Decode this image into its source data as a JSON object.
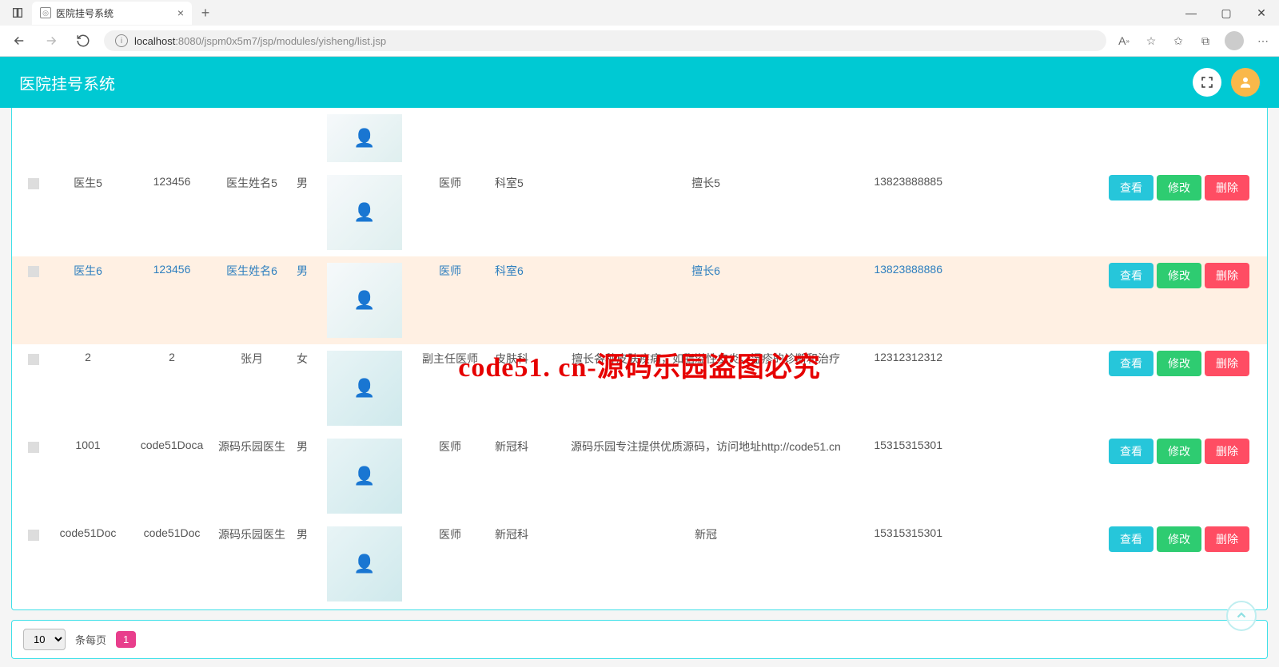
{
  "browser": {
    "tab_title": "医院挂号系统",
    "url_host": "localhost",
    "url_port_path": ":8080/jspm0x5m7/jsp/modules/yisheng/list.jsp"
  },
  "header": {
    "title": "医院挂号系统"
  },
  "buttons": {
    "view": "查看",
    "edit": "修改",
    "delete": "删除"
  },
  "rows": [
    {
      "account": "",
      "password": "",
      "name": "",
      "gender": "",
      "title": "",
      "dept": "",
      "specialty": "",
      "phone": ""
    },
    {
      "account": "医生5",
      "password": "123456",
      "name": "医生姓名5",
      "gender": "男",
      "title": "医师",
      "dept": "科室5",
      "specialty": "擅长5",
      "phone": "13823888885"
    },
    {
      "account": "医生6",
      "password": "123456",
      "name": "医生姓名6",
      "gender": "男",
      "title": "医师",
      "dept": "科室6",
      "specialty": "擅长6",
      "phone": "13823888886"
    },
    {
      "account": "2",
      "password": "2",
      "name": "张月",
      "gender": "女",
      "title": "副主任医师",
      "dept": "皮肤科",
      "specialty": "擅长各种皮肤疾病，如脂溢性皮炎，湿疹的诊断和治疗",
      "phone": "12312312312"
    },
    {
      "account": "1001",
      "password": "code51Doca",
      "name": "源码乐园医生",
      "gender": "男",
      "title": "医师",
      "dept": "新冠科",
      "specialty": "源码乐园专注提供优质源码，访问地址http://code51.cn",
      "phone": "15315315301"
    },
    {
      "account": "code51Doc",
      "password": "code51Doc",
      "name": "源码乐园医生",
      "gender": "男",
      "title": "医师",
      "dept": "新冠科",
      "specialty": "新冠",
      "phone": "15315315301"
    }
  ],
  "pager": {
    "page_size": "10",
    "label": "条每页",
    "current_page": "1"
  },
  "watermark": "code51. cn-源码乐园盗图必究"
}
